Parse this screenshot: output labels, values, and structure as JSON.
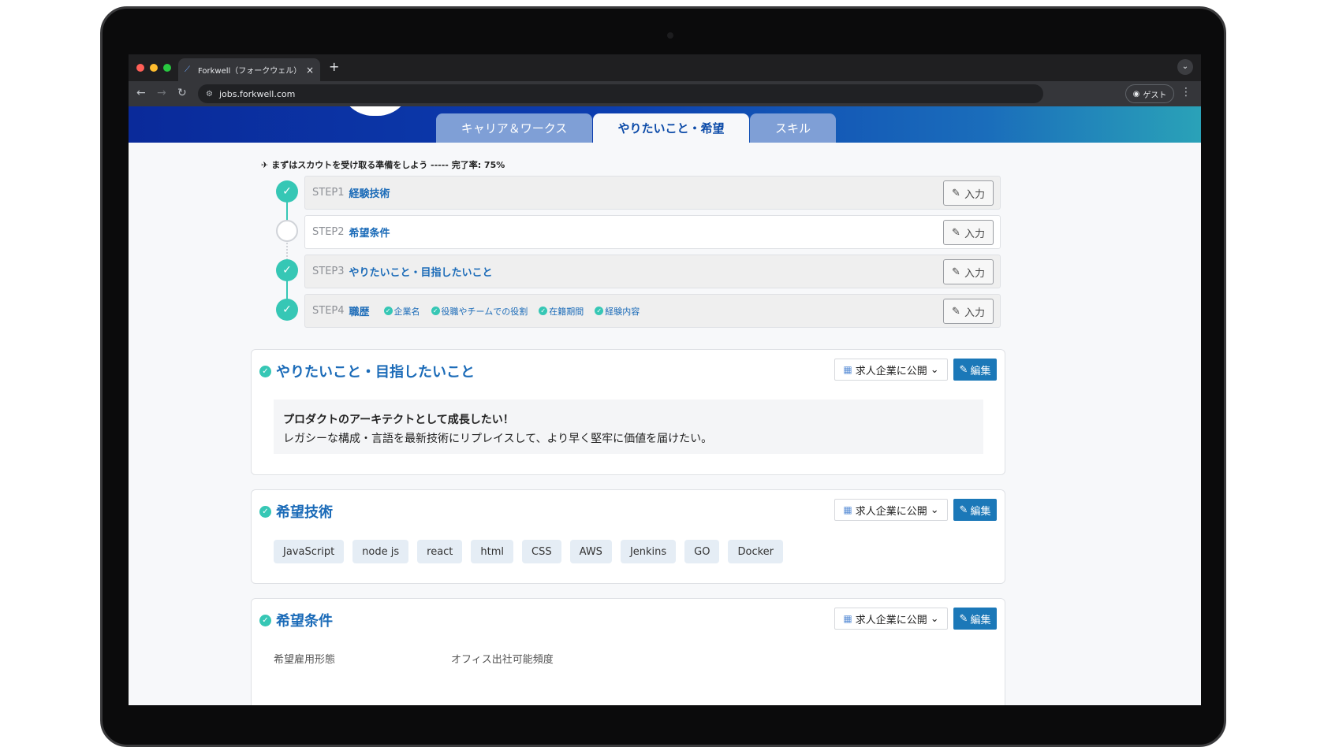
{
  "browser": {
    "tab_title": "Forkwell（フォークウェル）| IT",
    "tab_close": "×",
    "new_tab": "+",
    "url": "jobs.forkwell.com",
    "profile_label": "ゲスト",
    "traffic_colors": [
      "#ff5f57",
      "#febc2e",
      "#28c840"
    ]
  },
  "profile_tabs": [
    {
      "label": "キャリア＆ワークス",
      "active": false
    },
    {
      "label": "やりたいこと・希望",
      "active": true
    },
    {
      "label": "スキル",
      "active": false
    }
  ],
  "progress": {
    "title": "まずはスカウトを受け取る準備をしよう ----- 完了率: 75%",
    "steps": [
      {
        "no": "STEP1",
        "name": "経験技術",
        "done": true,
        "button": "入力"
      },
      {
        "no": "STEP2",
        "name": "希望条件",
        "done": false,
        "button": "入力"
      },
      {
        "no": "STEP3",
        "name": "やりたいこと・目指したいこと",
        "done": true,
        "button": "入力"
      },
      {
        "no": "STEP4",
        "name": "職歴",
        "done": true,
        "button": "入力",
        "substeps": [
          "企業名",
          "役職やチームでの役割",
          "在籍期間",
          "経験内容"
        ]
      }
    ]
  },
  "sections": {
    "goals": {
      "title": "やりたいこと・目指したいこと",
      "visibility": "求人企業に公開",
      "edit": "編集",
      "headline": "プロダクトのアーキテクトとして成長したい！",
      "body": "レガシーな構成・言語を最新技術にリプレイスして、より早く堅牢に価値を届けたい。"
    },
    "tech": {
      "title": "希望技術",
      "visibility": "求人企業に公開",
      "edit": "編集",
      "chips": [
        "JavaScript",
        "node js",
        "react",
        "html",
        "CSS",
        "AWS",
        "Jenkins",
        "GO",
        "Docker"
      ]
    },
    "conditions": {
      "title": "希望条件",
      "visibility": "求人企業に公開",
      "edit": "編集",
      "label_employment": "希望雇用形態",
      "label_office": "オフィス出社可能頻度"
    }
  },
  "colors": {
    "accent": "#1b6bb8",
    "check": "#36c7b5",
    "edit_button": "#1b78b8"
  }
}
